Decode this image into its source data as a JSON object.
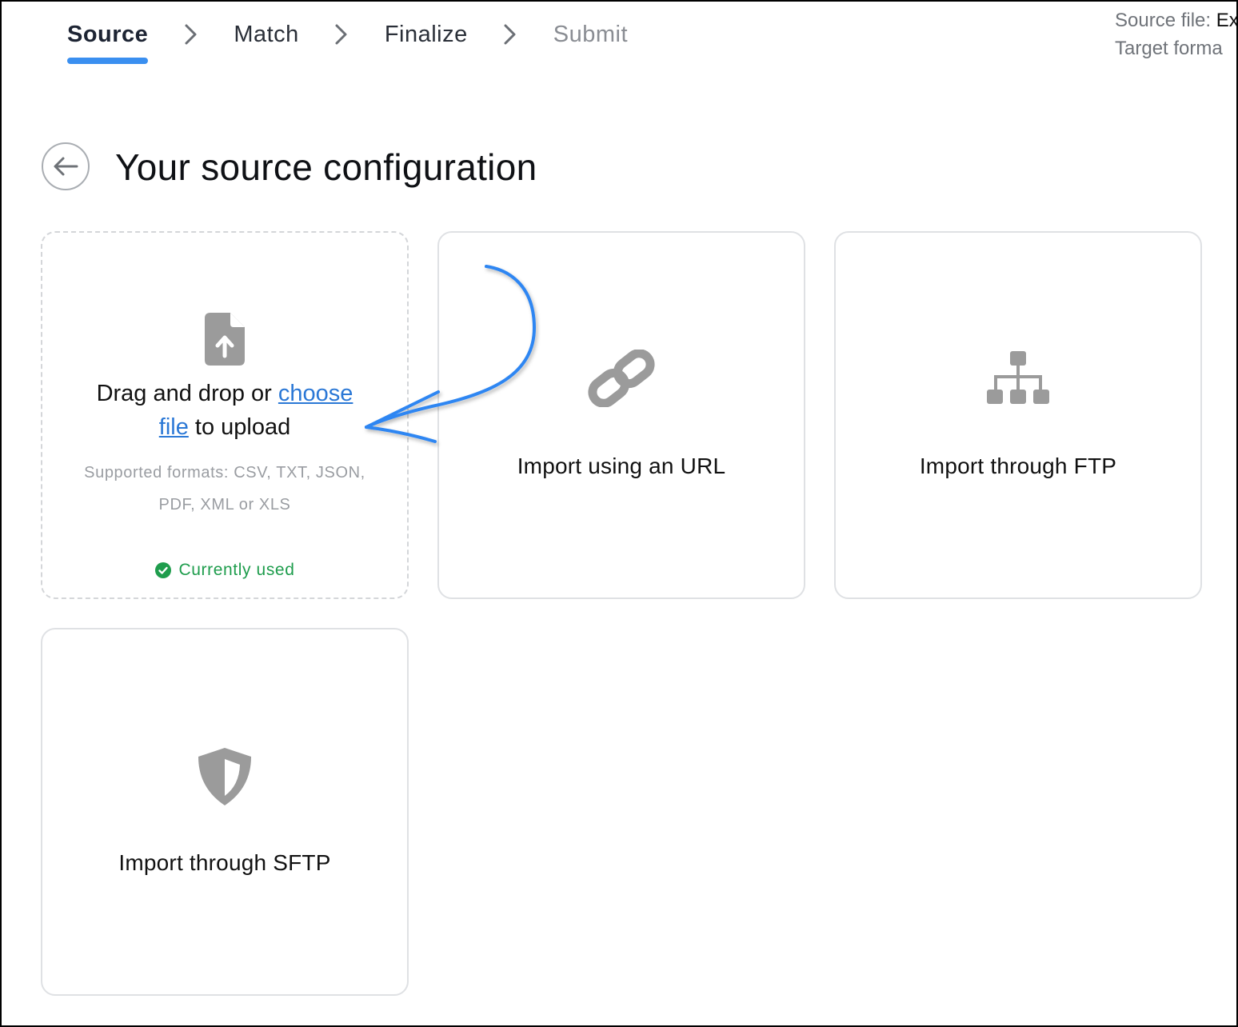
{
  "stepper": {
    "steps": [
      {
        "label": "Source",
        "state": "active"
      },
      {
        "label": "Match",
        "state": "done"
      },
      {
        "label": "Finalize",
        "state": "done"
      },
      {
        "label": "Submit",
        "state": "pending"
      }
    ],
    "separator_icon": "chevron-right-icon"
  },
  "meta": {
    "source_file_label": "Source file:",
    "source_file_value": "Ex",
    "target_format_label": "Target forma"
  },
  "header": {
    "back_icon": "arrow-left-icon",
    "title": "Your source configuration"
  },
  "options": {
    "upload": {
      "icon": "file-upload-icon",
      "text_before": "Drag and drop or ",
      "link_part1": "choose",
      "link_part2": "file",
      "text_after": " to upload",
      "formats_line1": "Supported formats: CSV, TXT, JSON,",
      "formats_line2": "PDF, XML or XLS",
      "status": "Currently used",
      "status_icon": "check-circle-icon"
    },
    "url": {
      "icon": "link-icon",
      "label": "Import using an URL"
    },
    "ftp": {
      "icon": "sitemap-icon",
      "label": "Import through FTP"
    },
    "sftp": {
      "icon": "shield-icon",
      "label": "Import through SFTP"
    }
  },
  "colors": {
    "accent": "#3a8ff0",
    "link": "#2b78d6",
    "success": "#1f9d4d",
    "icon_gray": "#9b9b9b",
    "annotation_arrow": "#2f86f2"
  }
}
